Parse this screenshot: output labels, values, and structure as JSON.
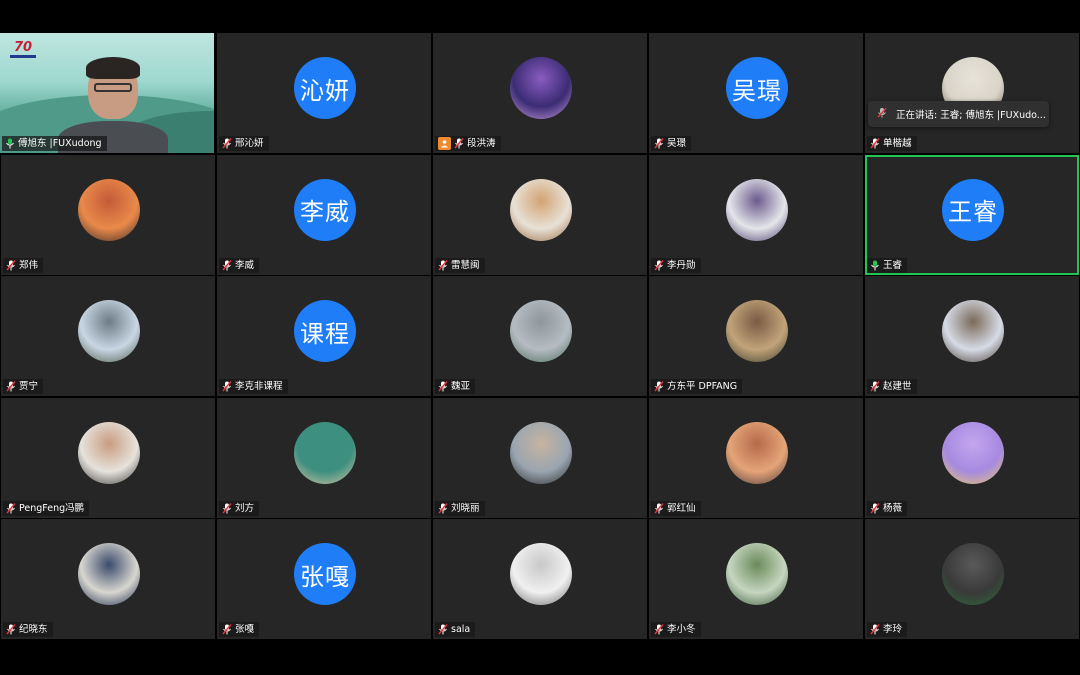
{
  "talking_banner": "正在讲话: 王睿; 傅旭东 |FUXudo...",
  "tiles": [
    {
      "name": "傅旭东 |FUXudong",
      "type": "video",
      "mic": "on"
    },
    {
      "name": "邢沁妍",
      "type": "text",
      "avatar_text": "沁妍",
      "mic": "muted"
    },
    {
      "name": "段洪涛",
      "type": "photo",
      "colors": [
        "#3b2c74",
        "#8a5cc0",
        "#c79be0"
      ],
      "mic": "muted",
      "camera_icon": true
    },
    {
      "name": "吴璟",
      "type": "text",
      "avatar_text": "吴璟",
      "mic": "muted"
    },
    {
      "name": "单楷越",
      "type": "photo",
      "colors": [
        "#d9d4c8",
        "#e8e3da",
        "#6a5a48"
      ],
      "mic": "muted"
    },
    {
      "name": "郑伟",
      "type": "photo",
      "colors": [
        "#e98a4a",
        "#c45a38",
        "#3a2a2a"
      ],
      "mic": "muted"
    },
    {
      "name": "李威",
      "type": "text",
      "avatar_text": "李威",
      "mic": "muted"
    },
    {
      "name": "雷慧闽",
      "type": "photo",
      "colors": [
        "#e8e1d6",
        "#d2a373",
        "#9a6c44"
      ],
      "mic": "muted"
    },
    {
      "name": "李丹勋",
      "type": "photo",
      "colors": [
        "#e4e6ea",
        "#6b5a8c",
        "#4b3a6c"
      ],
      "mic": "muted"
    },
    {
      "name": "王睿",
      "type": "text",
      "avatar_text": "王睿",
      "mic": "on",
      "speaking": true
    },
    {
      "name": "贾宁",
      "type": "photo",
      "colors": [
        "#c9d6e4",
        "#6d7c86",
        "#4b5a4a"
      ],
      "mic": "muted"
    },
    {
      "name": "李克非课程",
      "type": "text",
      "avatar_text": "课程",
      "mic": "muted"
    },
    {
      "name": "魏亚",
      "type": "photo",
      "colors": [
        "#b5bcc2",
        "#8e979d",
        "#4a6a5a"
      ],
      "mic": "muted"
    },
    {
      "name": "方东平 DPFANG",
      "type": "photo",
      "colors": [
        "#c2a47a",
        "#7a5a44",
        "#3a3a2a"
      ],
      "mic": "muted"
    },
    {
      "name": "赵建世",
      "type": "photo",
      "colors": [
        "#d6dbe6",
        "#7a6a5a",
        "#4a3a30"
      ],
      "mic": "muted"
    },
    {
      "name": "PengFeng冯鹏",
      "type": "photo",
      "colors": [
        "#e6e2dc",
        "#c89c80",
        "#3a3a3a"
      ],
      "mic": "muted"
    },
    {
      "name": "刘方",
      "type": "photo",
      "colors": [
        "#3d8f7f",
        "#3d8f7f",
        "#d8c6a4"
      ],
      "mic": "muted"
    },
    {
      "name": "刘晓丽",
      "type": "photo",
      "colors": [
        "#9aa5b0",
        "#c6b4a0",
        "#2a2a2a"
      ],
      "mic": "muted"
    },
    {
      "name": "郭红仙",
      "type": "photo",
      "colors": [
        "#e5a478",
        "#b46a4a",
        "#4a3a3a"
      ],
      "mic": "muted"
    },
    {
      "name": "杨薇",
      "type": "photo",
      "colors": [
        "#a68ae0",
        "#c4a6ee",
        "#e8c86a"
      ],
      "mic": "muted"
    },
    {
      "name": "纪晓东",
      "type": "photo",
      "colors": [
        "#d8d6d0",
        "#3a4a6a",
        "#1a2a4a"
      ],
      "mic": "muted"
    },
    {
      "name": "张嘎",
      "type": "text",
      "avatar_text": "张嘎",
      "mic": "muted"
    },
    {
      "name": "sala",
      "type": "photo",
      "colors": [
        "#f0f0f0",
        "#c8c8c8",
        "#6a6a6a"
      ],
      "mic": "muted"
    },
    {
      "name": "李小冬",
      "type": "photo",
      "colors": [
        "#c6d6c0",
        "#6a8a5a",
        "#3a5a3a"
      ],
      "mic": "muted"
    },
    {
      "name": "李玲",
      "type": "photo",
      "colors": [
        "#3a3a3a",
        "#5a5a5a",
        "#2a6a3a"
      ],
      "mic": "muted"
    }
  ],
  "colors": {
    "tile_bg": "#262626",
    "avatar_blue": "#1f7ef7",
    "speaking_green": "#23c552",
    "muted_red": "#e0383e",
    "camera_orange": "#f08a2e"
  }
}
